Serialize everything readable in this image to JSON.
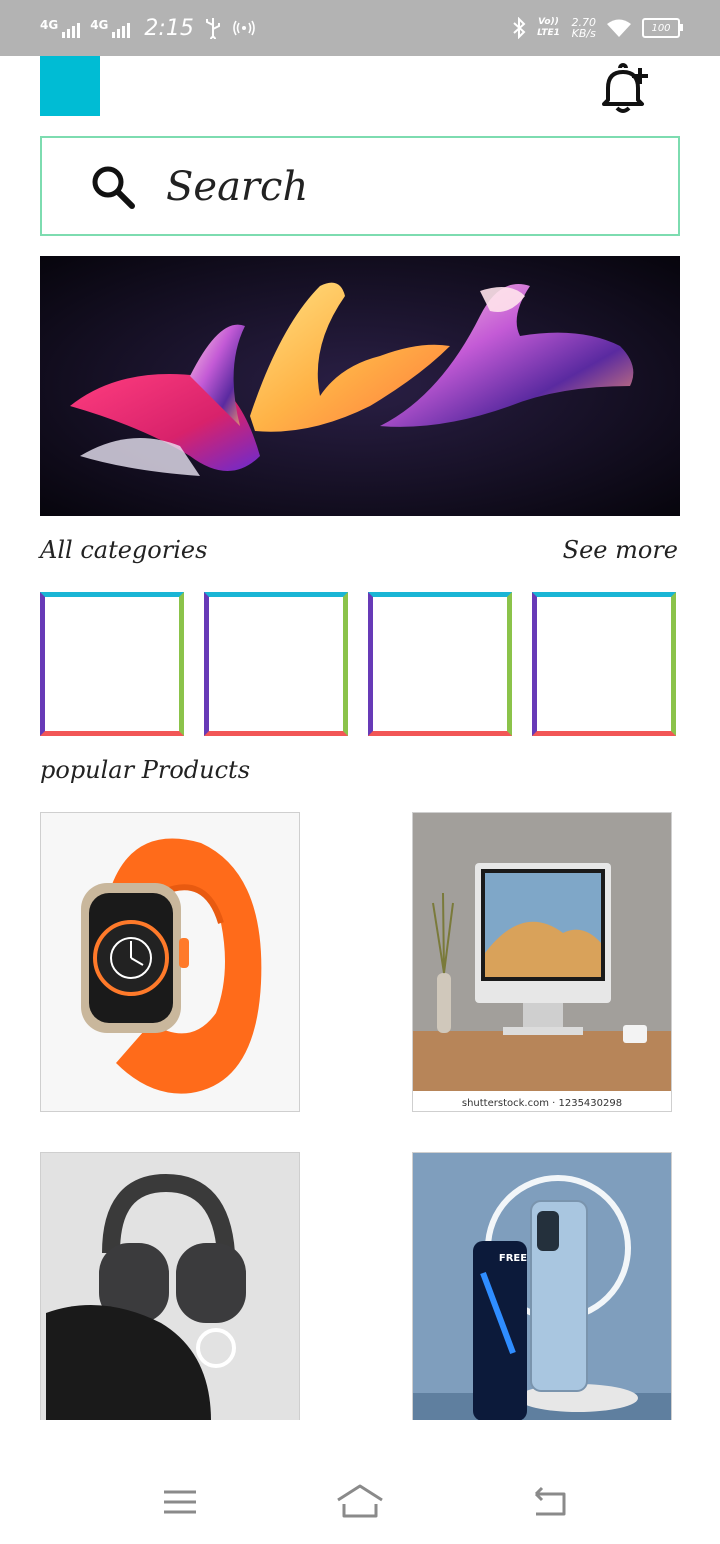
{
  "status_bar": {
    "net1": "4G",
    "net2": "4G",
    "time": "2:15",
    "volte": "Vo)) LTE1",
    "speed_value": "2.70",
    "speed_unit": "KB/s",
    "battery": "100",
    "icons": [
      "usb-icon",
      "hotspot-icon",
      "bluetooth-icon",
      "wifi-icon",
      "battery-icon"
    ]
  },
  "header": {
    "logo_color": "#00bcd4",
    "icon": "notification-add-icon"
  },
  "search": {
    "placeholder": "Search",
    "border_color": "#7ddcb0"
  },
  "banner": {
    "image": "abstract-3d-ribbon-art"
  },
  "categories": {
    "title": "All categories",
    "see_more": "See more",
    "tile_colors": {
      "top": "#1ab5d5",
      "left": "#673ab7",
      "right": "#8bc34a",
      "bottom": "#f25656"
    },
    "count": 4
  },
  "popular": {
    "title": "popular Products",
    "products": [
      {
        "image": "orange-smartwatch"
      },
      {
        "image": "desktop-computer",
        "caption": "shutterstock.com · 1235430298"
      },
      {
        "image": "over-ear-headphones"
      },
      {
        "image": "smartphones",
        "badge": "FREE"
      }
    ]
  },
  "nav_bar": {
    "icons": [
      "menu-icon",
      "home-icon",
      "back-icon"
    ]
  }
}
